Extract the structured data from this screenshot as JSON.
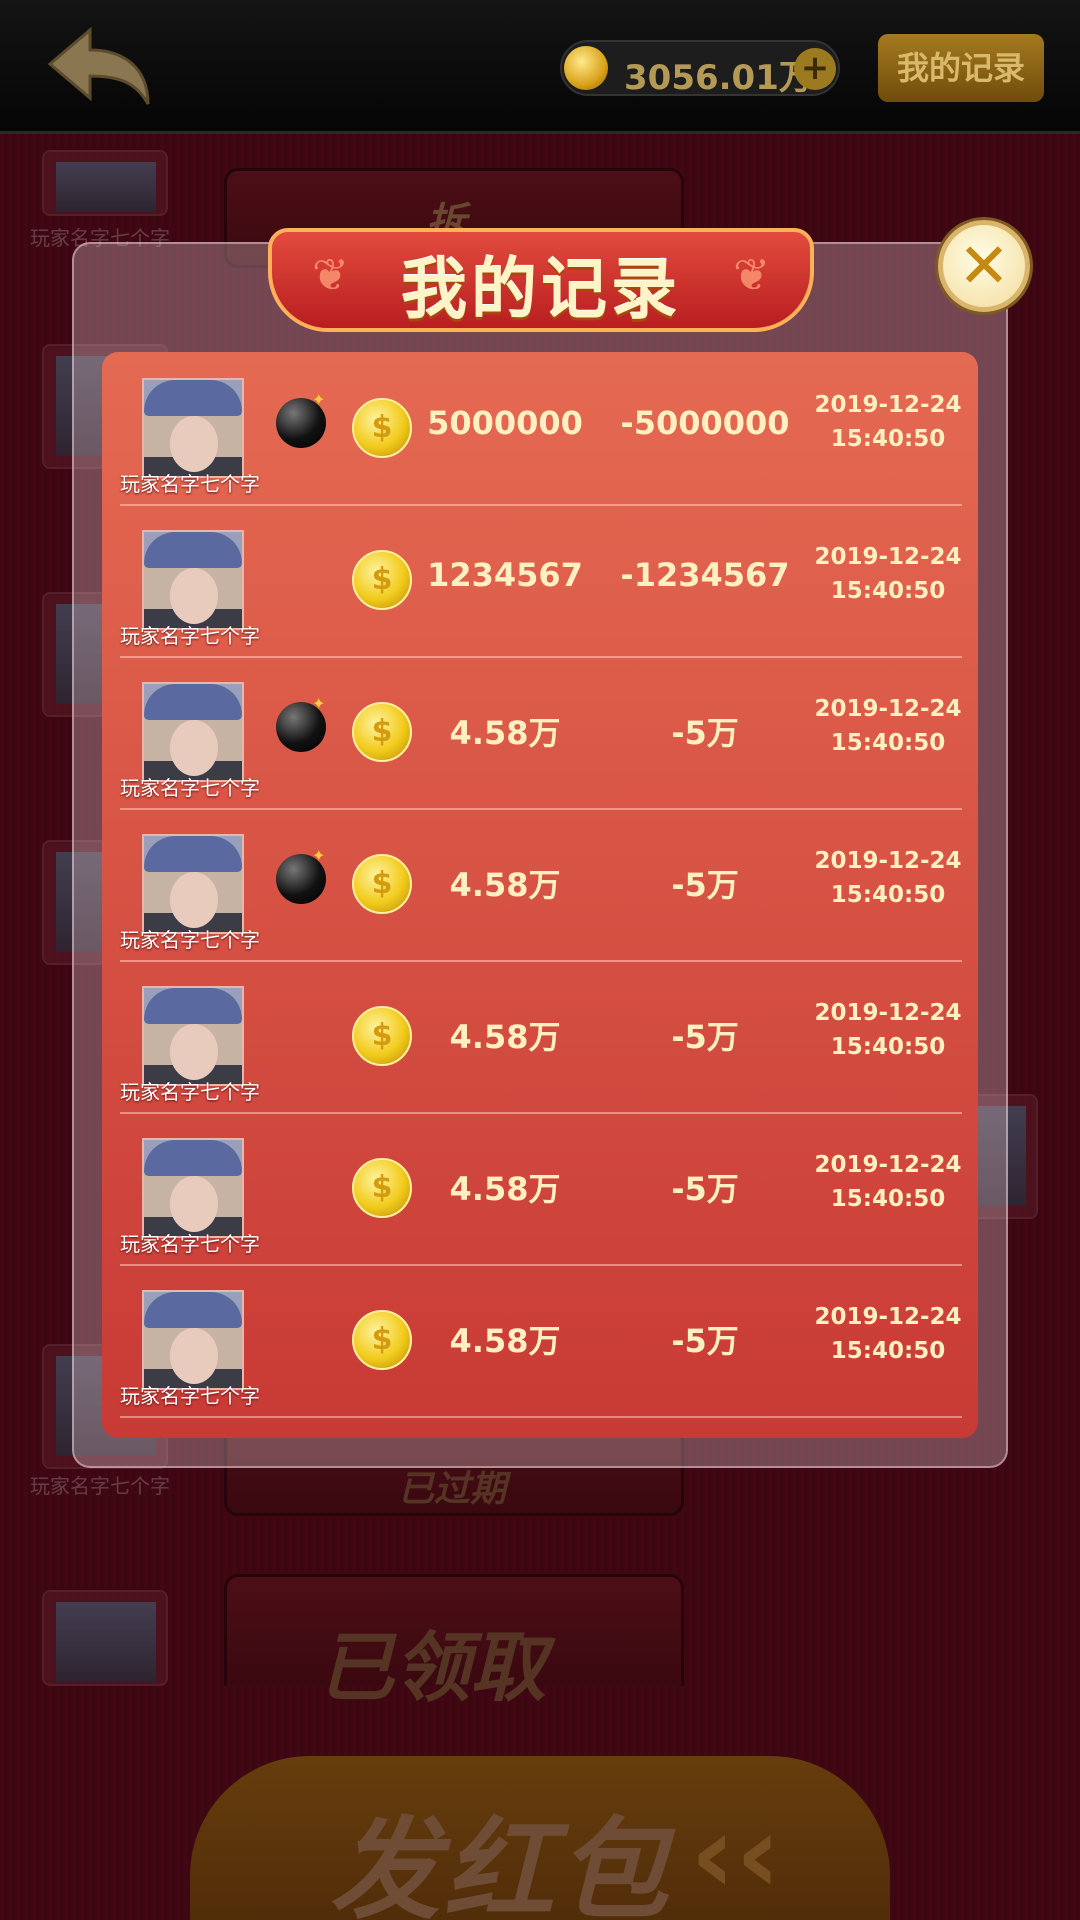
{
  "header": {
    "balance": "3056.01万",
    "plus_label": "+",
    "record_button_label": "我的记录"
  },
  "background": {
    "player_name": "玩家名字七个字",
    "envelope_open_label": "拆",
    "expired_label": "已过期",
    "claimed_label": "已领取",
    "send_button_label": "发红包",
    "send_arrows": "‹‹"
  },
  "modal": {
    "title": "我的记录",
    "close_label": "✕",
    "records": [
      {
        "name": "玩家名字七个字",
        "bomb": true,
        "bet": "5000000",
        "result": "-5000000",
        "date": "2019-12-24",
        "time": "15:40:50"
      },
      {
        "name": "玩家名字七个字",
        "bomb": false,
        "bet": "1234567",
        "result": "-1234567",
        "date": "2019-12-24",
        "time": "15:40:50"
      },
      {
        "name": "玩家名字七个字",
        "bomb": true,
        "bet": "4.58万",
        "result": "-5万",
        "date": "2019-12-24",
        "time": "15:40:50"
      },
      {
        "name": "玩家名字七个字",
        "bomb": true,
        "bet": "4.58万",
        "result": "-5万",
        "date": "2019-12-24",
        "time": "15:40:50"
      },
      {
        "name": "玩家名字七个字",
        "bomb": false,
        "bet": "4.58万",
        "result": "-5万",
        "date": "2019-12-24",
        "time": "15:40:50"
      },
      {
        "name": "玩家名字七个字",
        "bomb": false,
        "bet": "4.58万",
        "result": "-5万",
        "date": "2019-12-24",
        "time": "15:40:50"
      },
      {
        "name": "玩家名字七个字",
        "bomb": false,
        "bet": "4.58万",
        "result": "-5万",
        "date": "2019-12-24",
        "time": "15:40:50"
      }
    ]
  },
  "icons": {
    "back": "back-arrow-icon",
    "coin": "gold-coin-icon",
    "bomb": "bomb-icon",
    "close": "close-icon"
  },
  "colors": {
    "panel_top": "#e56a52",
    "panel_bottom": "#c83a35",
    "text_gold": "#fff0c2",
    "background": "#5a0f1e"
  }
}
